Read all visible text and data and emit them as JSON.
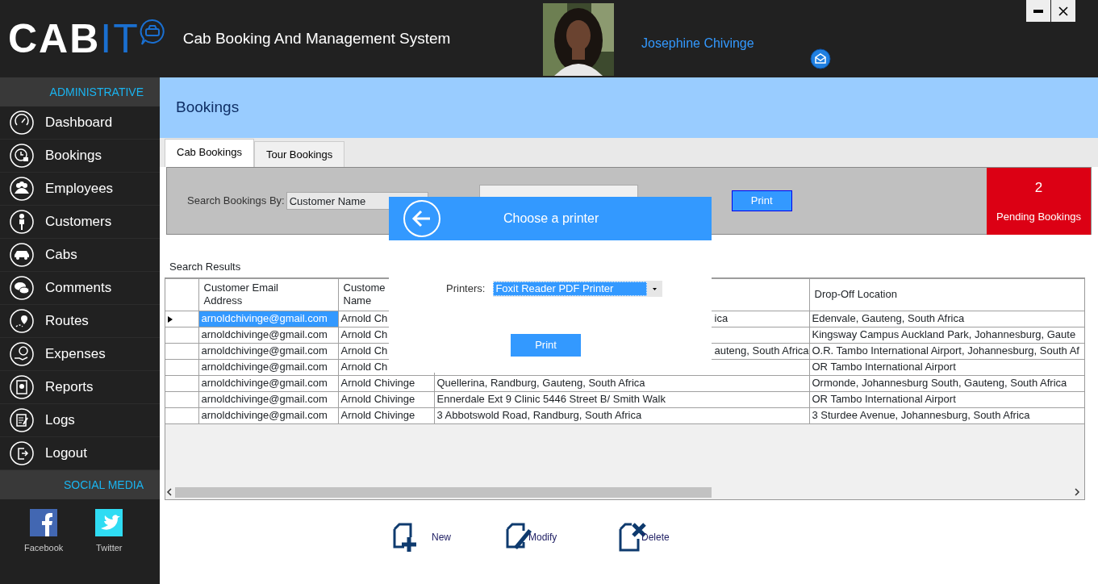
{
  "header": {
    "logo_main": "CAB",
    "logo_accent": "IT",
    "title": "Cab Booking And Management System",
    "user_name": "Josephine Chivinge"
  },
  "sidebar": {
    "heading": "ADMINISTRATIVE",
    "items": [
      {
        "label": "Dashboard"
      },
      {
        "label": "Bookings"
      },
      {
        "label": "Employees"
      },
      {
        "label": "Customers"
      },
      {
        "label": "Cabs"
      },
      {
        "label": "Comments"
      },
      {
        "label": "Routes"
      },
      {
        "label": "Expenses"
      },
      {
        "label": "Reports"
      },
      {
        "label": "Logs"
      },
      {
        "label": "Logout"
      }
    ],
    "social_heading": "SOCIAL MEDIA",
    "social": [
      {
        "label": "Facebook",
        "color": "#4267b2"
      },
      {
        "label": "Twitter",
        "color": "#2fdcf3"
      }
    ]
  },
  "page": {
    "title": "Bookings"
  },
  "tabs": [
    {
      "label": "Cab Bookings",
      "selected": true
    },
    {
      "label": "Tour Bookings",
      "selected": false
    }
  ],
  "search": {
    "label": "Search Bookings By:",
    "by": "Customer Name",
    "print_button": "Print"
  },
  "pending": {
    "count": "2",
    "label": "Pending Bookings"
  },
  "results": {
    "title": "Search Results",
    "columns": [
      {
        "lines": [
          "Customer Email",
          "Address"
        ]
      },
      {
        "lines": [
          "Custome",
          "Name"
        ]
      },
      {
        "lines": [
          "Drop-Off Location"
        ]
      }
    ],
    "rows": [
      {
        "selected": true,
        "email": "arnoldchivinge@gmail.com",
        "name": "Arnold Ch",
        "pickup": "ica",
        "dropoff": "Edenvale, Gauteng, South Africa"
      },
      {
        "selected": false,
        "email": "arnoldchivinge@gmail.com",
        "name": "Arnold Ch",
        "dropoff": "Kingsway Campus Auckland Park, Johannesburg, Gaute"
      },
      {
        "selected": false,
        "email": "arnoldchivinge@gmail.com",
        "name": "Arnold Ch",
        "pickup": "auteng, South Africa",
        "dropoff": "O.R. Tambo International Airport, Johannesburg, South Af"
      },
      {
        "selected": false,
        "email": "arnoldchivinge@gmail.com",
        "name": "Arnold Ch",
        "dropoff": "OR Tambo International Airport"
      },
      {
        "selected": false,
        "email": "arnoldchivinge@gmail.com",
        "name": "Arnold Chivinge",
        "pickup": "Quellerina, Randburg, Gauteng, South Africa",
        "dropoff": "Ormonde, Johannesburg South, Gauteng, South Africa"
      },
      {
        "selected": false,
        "email": "arnoldchivinge@gmail.com",
        "name": "Arnold Chivinge",
        "pickup": "Ennerdale Ext 9 Clinic 5446 Street B/ Smith Walk",
        "dropoff": "OR Tambo International Airport"
      },
      {
        "selected": false,
        "email": "arnoldchivinge@gmail.com",
        "name": "Arnold Chivinge",
        "pickup": "3 Abbotswold Road, Randburg, South Africa",
        "dropoff": "3 Sturdee Avenue, Johannesburg, South Africa"
      }
    ]
  },
  "dialog": {
    "title": "Choose a printer",
    "printers_label": "Printers:",
    "printer": "Foxit Reader PDF Printer",
    "print_button": "Print"
  },
  "actions": [
    {
      "label": "New"
    },
    {
      "label": "Modify"
    },
    {
      "label": "Delete"
    }
  ]
}
